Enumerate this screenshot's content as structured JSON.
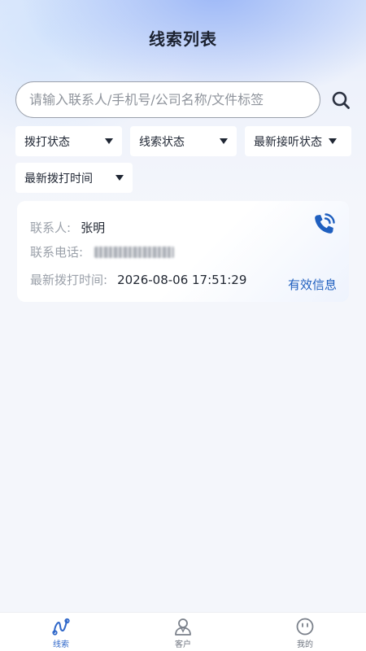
{
  "header": {
    "title": "线索列表"
  },
  "search": {
    "placeholder": "请输入联系人/手机号/公司名称/文件标签",
    "value": ""
  },
  "filters": [
    {
      "label": "拨打状态"
    },
    {
      "label": "线索状态"
    },
    {
      "label": "最新接听状态"
    },
    {
      "label": "最新拨打时间"
    }
  ],
  "card": {
    "contact_label": "联系人:",
    "contact_value": "张明",
    "phone_label": "联系电话:",
    "last_call_label": "最新拨打时间:",
    "last_call_value": "2026-08-06 17:51:29",
    "tag": "有效信息"
  },
  "tabbar": {
    "items": [
      {
        "label": "线索",
        "icon": "clue-icon",
        "active": true
      },
      {
        "label": "客户",
        "icon": "customer-icon",
        "active": false
      },
      {
        "label": "我的",
        "icon": "profile-icon",
        "active": false
      }
    ]
  },
  "colors": {
    "accent": "#2f67c9",
    "tag": "#1f5fbf",
    "background": "#f4f6fb"
  }
}
